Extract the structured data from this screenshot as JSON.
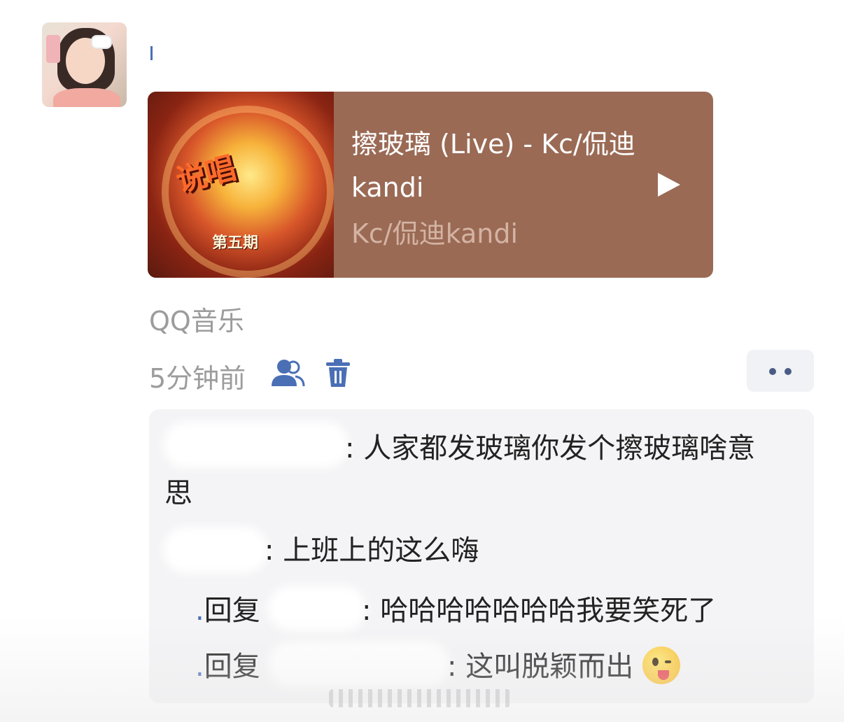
{
  "post": {
    "music_card": {
      "title": "擦玻璃 (Live) - Kc/侃迪kandi",
      "artist": "Kc/侃迪kandi",
      "cover_badge": "第五期",
      "cover_art_text": "说唱",
      "background_color": "#9a6a55"
    },
    "source": "QQ音乐",
    "time": "5分钟前",
    "icons": {
      "friends": "friends-icon",
      "delete": "trash-icon",
      "more": "more-icon",
      "play": "play-icon"
    }
  },
  "comments": [
    {
      "text": ": 人家都发玻璃你发个擦玻璃啥意思"
    },
    {
      "text": ": 上班上的这么嗨"
    },
    {
      "reply_word": "回复",
      "text": ": 哈哈哈哈哈哈哈我要笑死了"
    },
    {
      "reply_word": "回复",
      "text": ": 这叫脱颖而出"
    }
  ]
}
